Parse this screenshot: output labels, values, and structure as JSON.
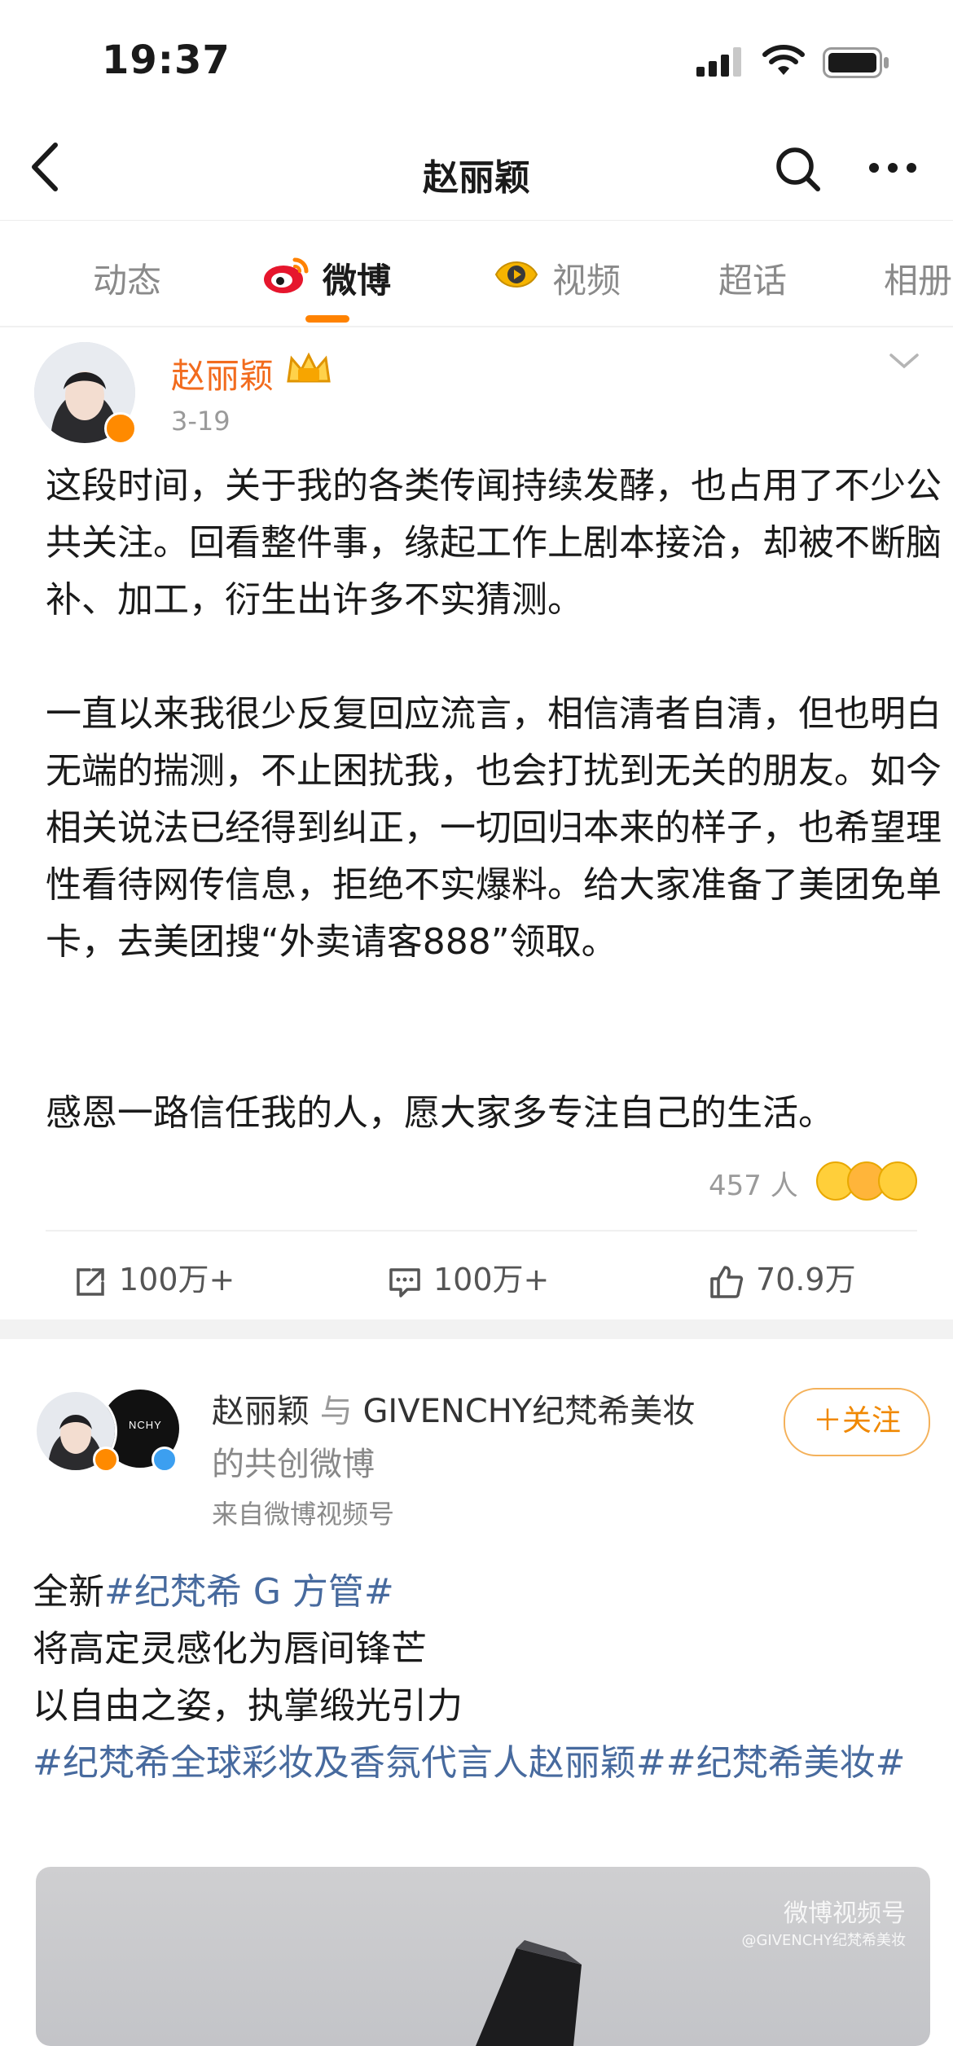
{
  "status": {
    "time": "19:37"
  },
  "nav": {
    "title": "赵丽颖"
  },
  "tabs": [
    {
      "label": "动态"
    },
    {
      "label": "微博"
    },
    {
      "label": "视频"
    },
    {
      "label": "超话"
    },
    {
      "label": "相册"
    }
  ],
  "post1": {
    "author": "赵丽颖",
    "date": "3-19",
    "paragraphs": [
      "这段时间，关于我的各类传闻持续发酵，也占用了不少公共关注。回看整件事，缘起工作上剧本接洽，却被不断脑补、加工，衍生出许多不实猜测。",
      "一直以来我很少反复回应流言，相信清者自清，但也明白无端的揣测，不止困扰我，也会打扰到无关的朋友。如今相关说法已经得到纠正，一切回归本来的样子，也希望理性看待网传信息，拒绝不实爆料。给大家准备了美团免单卡，去美团搜“外卖请客888”领取。",
      "感恩一路信任我的人，愿大家多专注自己的生活。"
    ],
    "reactions": "457 人",
    "repost": "100万+",
    "comment": "100万+",
    "like": "70.9万"
  },
  "post2": {
    "author": "赵丽颖",
    "joiner": "与",
    "partner": "GIVENCHY纪梵希美妆",
    "suffix": "的共创微博",
    "source_prefix": "来自",
    "source": "微博视频号",
    "follow": "＋关注",
    "partner_avatar_text": "NCHY",
    "line1_prefix": "全新",
    "line1_tag": "#纪梵希 G 方管#",
    "line2": "将高定灵感化为唇间锋芒",
    "line3": "以自由之姿，执掌缎光引力",
    "line4_tags": "#纪梵希全球彩妆及香氛代言人赵丽颖##纪梵希美妆#",
    "watermark": "微博视频号",
    "watermark_sub": "@GIVENCHY纪梵希美妆"
  },
  "colors": {
    "accent": "#ff8200",
    "author_orange": "#f26b1d",
    "hashtag": "#476a9e"
  }
}
